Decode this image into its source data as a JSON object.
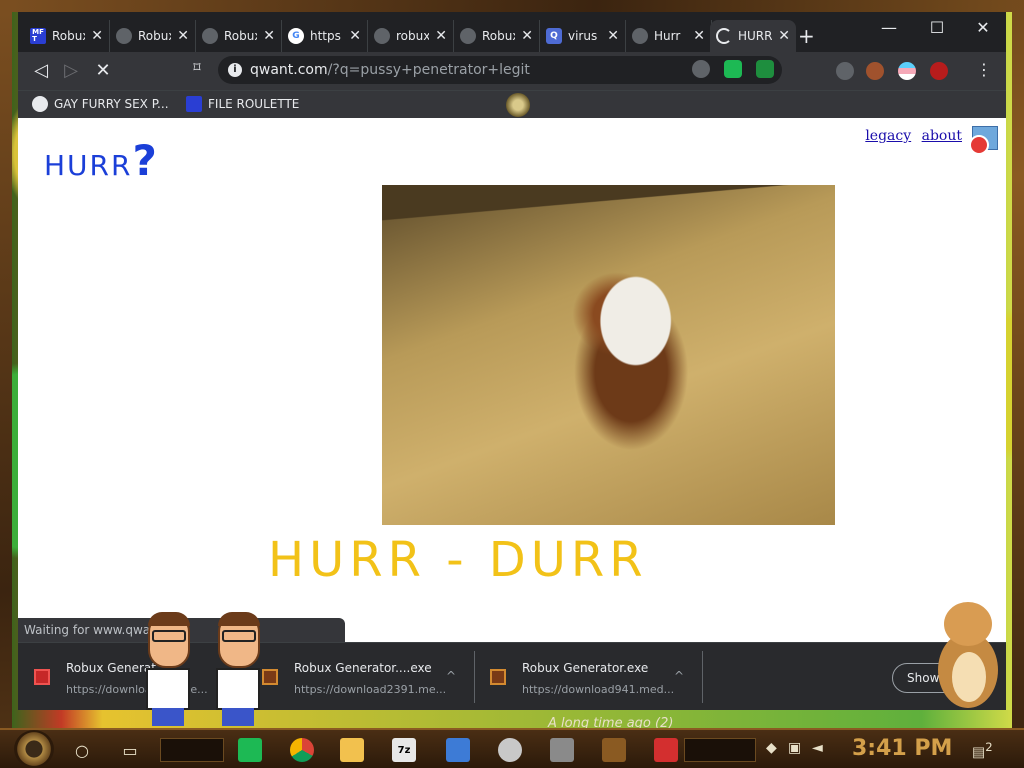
{
  "browser": {
    "tabs": [
      {
        "title": "Robux",
        "icon": "mft-favicon"
      },
      {
        "title": "Robux",
        "icon": "globe-favicon"
      },
      {
        "title": "Robux",
        "icon": "globe-favicon"
      },
      {
        "title": "https",
        "icon": "google-favicon"
      },
      {
        "title": "robux",
        "icon": "globe-favicon"
      },
      {
        "title": "Robux",
        "icon": "globe-favicon"
      },
      {
        "title": "virus",
        "icon": "qwant-favicon"
      },
      {
        "title": "Hurr",
        "icon": "globe-favicon"
      },
      {
        "title": "HURR",
        "icon": "loading-spinner",
        "active": true
      }
    ],
    "new_tab_glyph": "+",
    "window_controls": {
      "minimize": "—",
      "maximize": "☐",
      "close": "✕"
    },
    "nav": {
      "back": "◁",
      "forward": "▷",
      "stop": "✕"
    },
    "url": {
      "host": "qwant.com",
      "path": "/?q=pussy+penetrator+legit"
    },
    "bookmarks": [
      {
        "label": "GAY FURRY SEX P...",
        "icon": "globe-favicon"
      },
      {
        "label": "FILE ROULETTE",
        "icon": "mft-favicon"
      }
    ]
  },
  "page": {
    "logo": {
      "text": "HURR",
      "mark": "?"
    },
    "links": {
      "legacy": "legacy",
      "about": "about"
    },
    "subtitle": "HURR - DURR",
    "status": "Waiting for www.qwan"
  },
  "downloads": [
    {
      "name": "Robux Generat",
      "source": "https://downloa",
      "tail": "me...",
      "icon_color": "#c62828"
    },
    {
      "name": "Robux Generator....exe",
      "source": "https://download2391.me...",
      "icon_color": "#7a3a16"
    },
    {
      "name": "Robux Generator.exe",
      "source": "https://download941.med...",
      "icon_color": "#7a3a16"
    }
  ],
  "downloads_show_all": "Show a",
  "taskbar": {
    "clock": "3:41 PM",
    "notification_count": "2",
    "background_text": "A long time ago (2)",
    "apps": [
      "spotify-icon",
      "chrome-icon",
      "file-explorer-icon",
      "7zip-icon",
      "cube-icon",
      "cloud-icon",
      "task-view-icon",
      "steampunk-app-icon",
      "roblox-icon"
    ]
  },
  "colors": {
    "logo": "#1b3fd8",
    "subtitle": "#f2c218",
    "chrome_dark": "#202124",
    "chrome_mid": "#35363a"
  }
}
